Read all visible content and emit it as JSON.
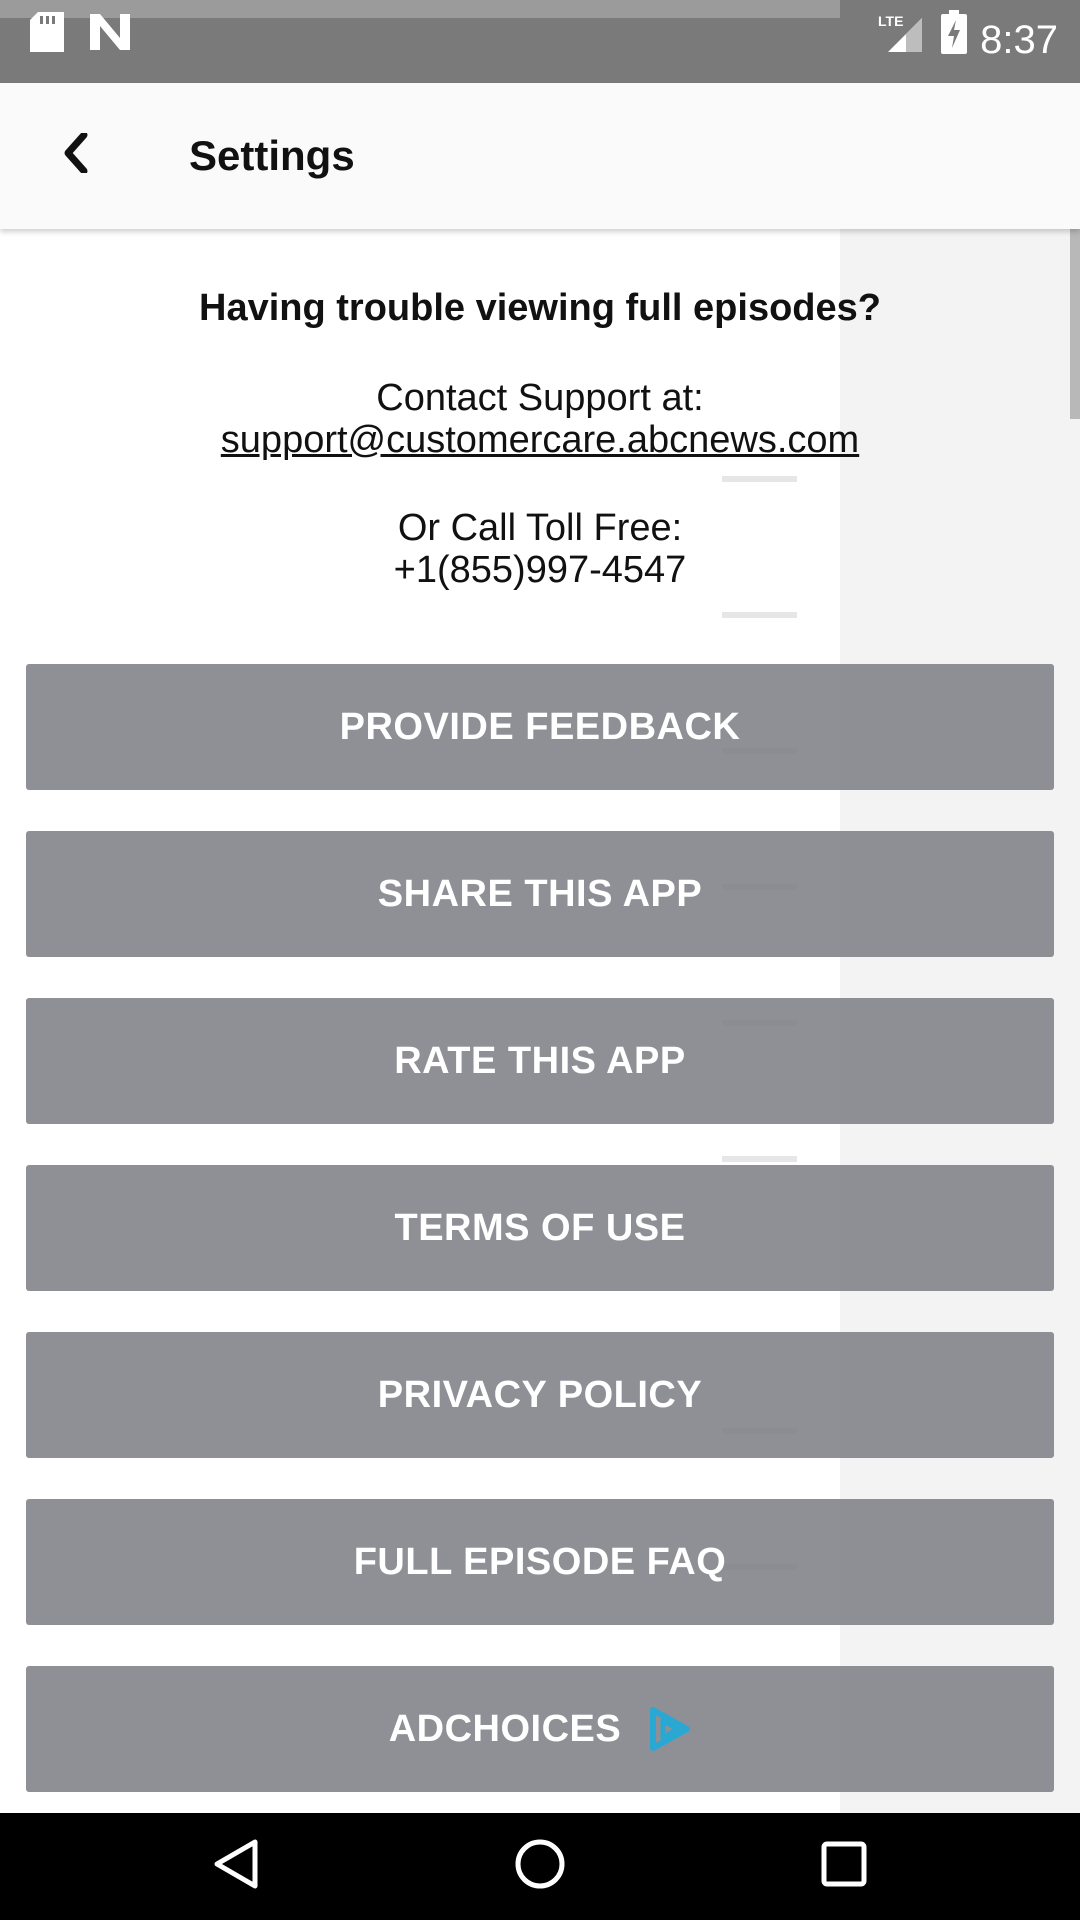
{
  "status_bar": {
    "time": "8:37",
    "network": "LTE",
    "icons": [
      "sd-card-icon",
      "n-logo-icon",
      "signal-icon",
      "battery-charging-icon"
    ]
  },
  "header": {
    "title": "Settings",
    "back_icon": "chevron-left-icon"
  },
  "support": {
    "heading": "Having trouble viewing full episodes?",
    "contact_label": "Contact Support at:",
    "email": "support@customercare.abcnews.com",
    "call_label": "Or Call Toll Free:",
    "phone": "+1(855)997-4547"
  },
  "buttons": [
    {
      "label": "PROVIDE FEEDBACK"
    },
    {
      "label": "SHARE THIS APP"
    },
    {
      "label": "RATE THIS APP"
    },
    {
      "label": "TERMS OF USE"
    },
    {
      "label": "PRIVACY POLICY"
    },
    {
      "label": "FULL EPISODE FAQ"
    },
    {
      "label": "ADCHOICES",
      "icon": "adchoices-icon"
    }
  ],
  "colors": {
    "button_bg": "#808087",
    "adchoices_accent": "#2aa8d4",
    "status_bar": "#7a7a7a"
  },
  "nav_bar": {
    "icons": [
      "back-triangle-icon",
      "home-circle-icon",
      "recents-square-icon"
    ]
  }
}
